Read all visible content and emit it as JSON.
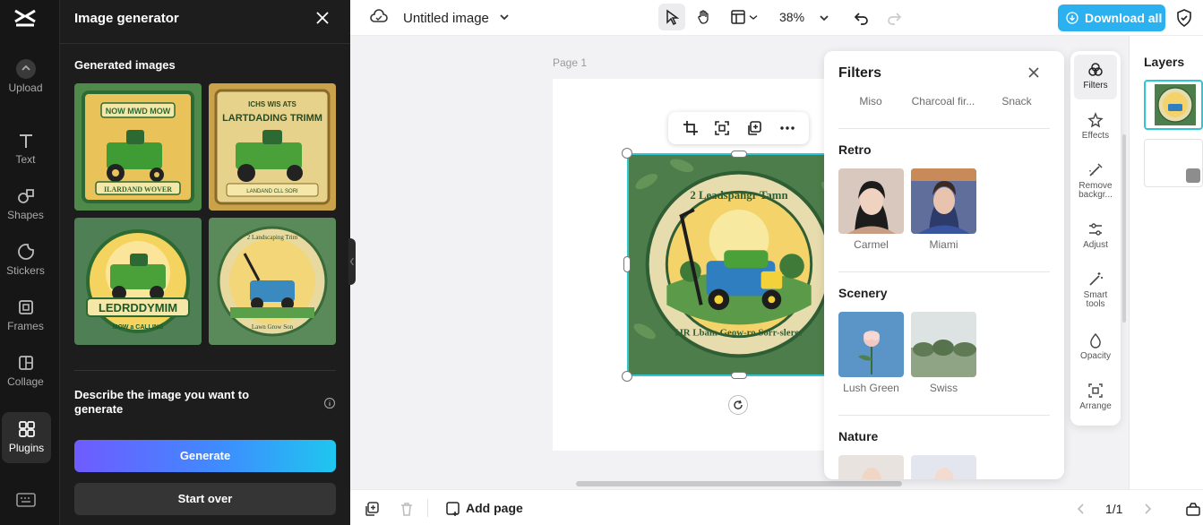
{
  "rail": {
    "items": [
      {
        "label": "Upload",
        "icon": "upload-icon"
      },
      {
        "label": "Text",
        "icon": "text-icon"
      },
      {
        "label": "Shapes",
        "icon": "shapes-icon"
      },
      {
        "label": "Stickers",
        "icon": "stickers-icon"
      },
      {
        "label": "Frames",
        "icon": "frames-icon"
      },
      {
        "label": "Collage",
        "icon": "collage-icon"
      },
      {
        "label": "Plugins",
        "icon": "plugins-icon",
        "active": true
      }
    ]
  },
  "panel": {
    "title": "Image generator",
    "subtitle": "Generated images",
    "describe_label": "Describe the image you want to generate",
    "generate_label": "Generate",
    "start_over_label": "Start over",
    "images": [
      {
        "title": "NOW MWD MOW",
        "caption": "ILARDAND WOVER"
      },
      {
        "title": "ICHS WIS ATS",
        "caption": "LARTDADING TRIMM",
        "sub": "LANDAND  CLL SORI"
      },
      {
        "title": "LEDRDDYMIM",
        "caption": "MOW a CALLING"
      },
      {
        "title": "2 Landscaping Trim",
        "caption": "Lawn Grow Son"
      }
    ]
  },
  "topbar": {
    "doc_title": "Untitled image",
    "zoom": "38%",
    "download_label": "Download all"
  },
  "canvas": {
    "page_label": "Page 1",
    "image_top_text": "2 Leadspahgr Tamn",
    "image_bottom_text": "IJR Lbam Geow-ro Sorr-slerer"
  },
  "filters": {
    "title": "Filters",
    "top_row": [
      "Miso",
      "Charcoal fir...",
      "Snack"
    ],
    "sections": [
      {
        "name": "Retro",
        "items": [
          "Carmel",
          "Miami"
        ]
      },
      {
        "name": "Scenery",
        "items": [
          "Lush Green",
          "Swiss"
        ]
      },
      {
        "name": "Nature",
        "items": []
      }
    ]
  },
  "tools": [
    {
      "label": "Filters",
      "icon": "filters-icon",
      "selected": true
    },
    {
      "label": "Effects",
      "icon": "effects-icon"
    },
    {
      "label": "Remove backgr...",
      "icon": "remove-background-icon"
    },
    {
      "label": "Adjust",
      "icon": "adjust-icon"
    },
    {
      "label": "Smart tools",
      "icon": "smart-tools-icon"
    },
    {
      "label": "Opacity",
      "icon": "opacity-icon"
    },
    {
      "label": "Arrange",
      "icon": "arrange-icon"
    }
  ],
  "layers": {
    "title": "Layers"
  },
  "bottombar": {
    "add_page_label": "Add page",
    "pager": "1/1"
  },
  "colors": {
    "accent": "#2ec6d2",
    "download_button": "#2bb0f0",
    "generate_gradient_start": "#6f5bff",
    "generate_gradient_end": "#1fc6ef"
  }
}
